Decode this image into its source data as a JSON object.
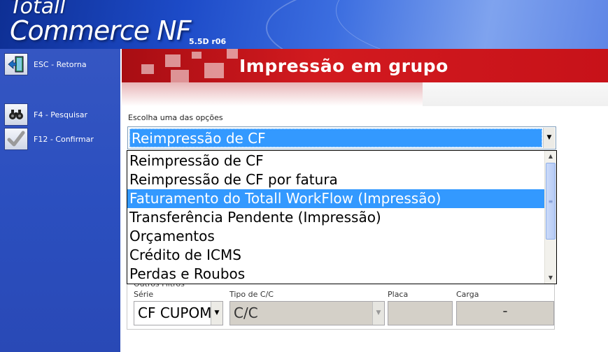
{
  "app": {
    "brand_top": "Totall",
    "brand_main": "Commerce NF",
    "version": "5.5D r06"
  },
  "sidebar": {
    "items": [
      {
        "label": "ESC - Retorna",
        "icon": "exit-door-icon"
      },
      {
        "label": "F4 - Pesquisar",
        "icon": "binoculars-icon"
      },
      {
        "label": "F12 - Confirmar",
        "icon": "checkmark-icon"
      }
    ]
  },
  "main": {
    "title": "Impressão em grupo",
    "choose_label": "Escolha uma das opções",
    "combo": {
      "selected": "Reimpressão de CF"
    },
    "dropdown": {
      "options": [
        "Reimpressão de CF",
        "Reimpressão de CF por fatura",
        "Faturamento do Totall WorkFlow (Impressão)",
        "Transferência Pendente (Impressão)",
        "Orçamentos",
        "Crédito de ICMS",
        "Perdas e Roubos"
      ],
      "highlighted_index": 2
    },
    "filters": {
      "legend": "Outros Filtros",
      "serie_label": "Série",
      "serie_value": "CF CUPOM",
      "tipo_label": "Tipo de C/C",
      "tipo_value": "C/C",
      "placa_label": "Placa",
      "placa_value": "",
      "carga_label": "Carga",
      "carga_value": "-"
    }
  },
  "colors": {
    "selection": "#3399ff",
    "title_red": "#c71219",
    "sidebar_blue": "#2b4fbf"
  }
}
